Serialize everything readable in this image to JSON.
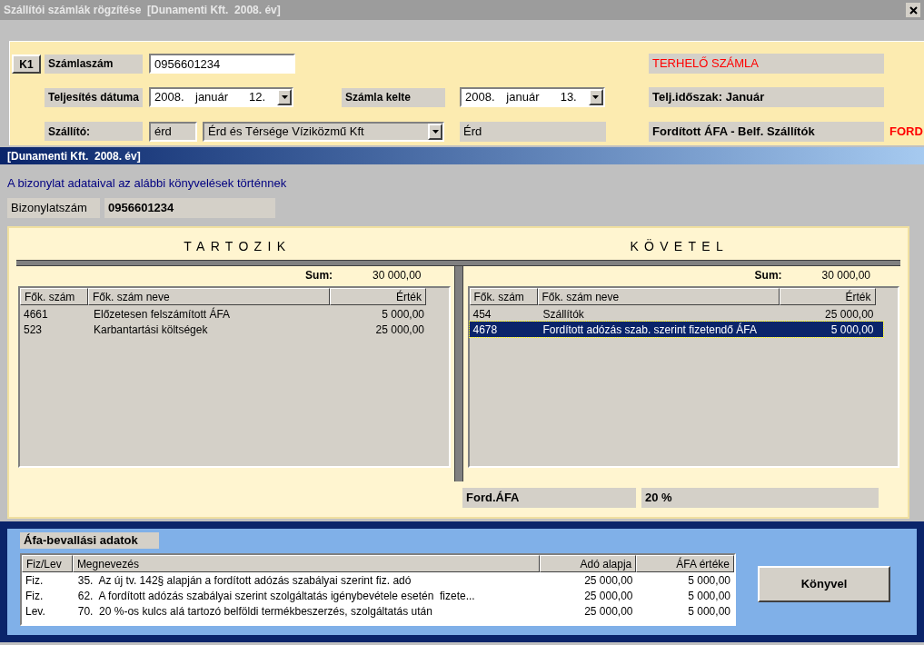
{
  "window": {
    "title": "Szállítói számlák rögzítése  [Dunamenti Kft.  2008. év]"
  },
  "form": {
    "k1": "K1",
    "invoice_number": {
      "label": "Számlaszám",
      "value": "0956601234"
    },
    "invoice_type": "TERHELŐ SZÁMLA",
    "completion_date": {
      "label": "Teljesítés dátuma",
      "year": "2008.",
      "month": "január",
      "day": "12."
    },
    "invoice_date": {
      "label": "Számla kelte",
      "year": "2008.",
      "month": "január",
      "day": "13."
    },
    "period": "Telj.időszak: Január",
    "supplier": {
      "label": "Szállító:",
      "code": "érd",
      "name": "Érd és Térsége Víziközmű Kft",
      "city": "Érd"
    },
    "vat_type": "Fordított ÁFA - Belf. Szállítók",
    "vat_flag": "FORD"
  },
  "dialog": {
    "title": "[Dunamenti Kft.  2008. év]",
    "message": "A bizonylat adataival az alábbi könyvelések történnek",
    "document": {
      "label": "Bizonylatszám",
      "value": "0956601234"
    },
    "sides": [
      {
        "title": "TARTOZIK",
        "sum_label": "Sum:",
        "sum": "30 000,00",
        "columns": [
          "Fők. szám",
          "Fők. szám neve",
          "Érték"
        ],
        "rows": [
          {
            "account": "4661",
            "name": "Előzetesen felszámított ÁFA",
            "value": "5 000,00",
            "selected": false
          },
          {
            "account": "523",
            "name": "Karbantartási költségek",
            "value": "25 000,00",
            "selected": false
          }
        ]
      },
      {
        "title": "KÖVETEL",
        "sum_label": "Sum:",
        "sum": "30 000,00",
        "columns": [
          "Fők. szám",
          "Fők. szám neve",
          "Érték"
        ],
        "rows": [
          {
            "account": "454",
            "name": "Szállítók",
            "value": "25 000,00",
            "selected": false
          },
          {
            "account": "4678",
            "name": "Fordított adózás szab. szerint fizetendő ÁFA",
            "value": "5 000,00",
            "selected": true
          }
        ]
      }
    ],
    "vat_rate": {
      "label": "Ford.ÁFA",
      "value": "20 %"
    }
  },
  "vat_report": {
    "title": "Áfa-bevallási adatok",
    "columns": [
      "Fiz/Lev",
      "Megnevezés",
      "Adó alapja",
      "ÁFA értéke"
    ],
    "rows": [
      {
        "type": "Fiz.",
        "description": "35.  Az új tv. 142§ alapján a fordított adózás szabályai szerint fiz. adó",
        "base": "25 000,00",
        "vat": "5 000,00"
      },
      {
        "type": "Fiz.",
        "description": "62.  A fordított adózás szabályai szerint szolgáltatás igénybevétele esetén  fizete...",
        "base": "25 000,00",
        "vat": "5 000,00"
      },
      {
        "type": "Lev.",
        "description": "70.  20 %-os kulcs alá tartozó belföldi termékbeszerzés, szolgáltatás után",
        "base": "25 000,00",
        "vat": "5 000,00"
      }
    ],
    "button": "Könyvel"
  }
}
